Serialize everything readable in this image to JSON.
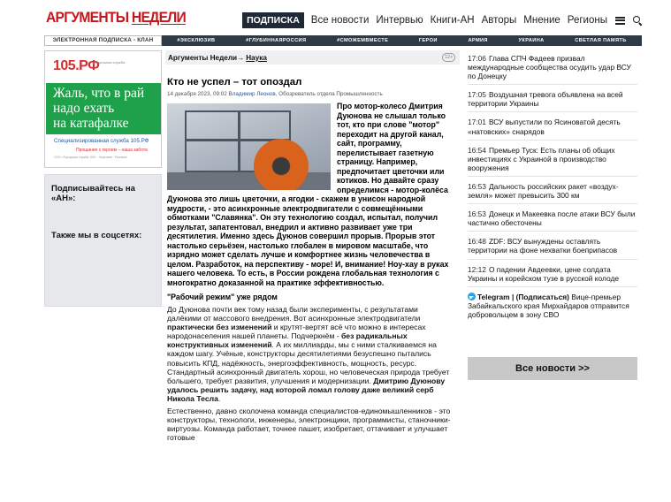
{
  "header": {
    "logo_part1": "АРГУМЕНТЫ ",
    "logo_part2": "НЕДЕЛИ",
    "nav": {
      "subscribe": "ПОДПИСКА",
      "items": [
        "Все новости",
        "Интервью",
        "Книги-АН",
        "Авторы",
        "Мнение",
        "Регионы"
      ]
    }
  },
  "subbar": {
    "left": "ЭЛЕКТРОННАЯ ПОДПИСКА - КЛАН",
    "tags": [
      "#ЭКСКЛЮЗИВ",
      "#ГЛУБИННАЯРОССИЯ",
      "#СМОЖЕМВМЕСТЕ",
      "ГЕРОИ",
      "АРМИЯ",
      "УКРАИНА",
      "СВЕТЛАЯ ПАМЯТЬ"
    ]
  },
  "ad": {
    "logo": "105.РФ",
    "logo_sub": "ритуальная служба",
    "headline_1": "Жаль, что в рай",
    "headline_2": "надо ехать",
    "headline_3": "на катафалке",
    "line1": "Специализированная служба 105.РФ",
    "line2": "Прощание с героем – наша забота",
    "small": "ООО «Городская служба 105» · Лицензия · Реклама"
  },
  "sidebar": {
    "subscribe": "Подписывайтесь на «АН»:",
    "social": "Также мы в соцсетях:"
  },
  "article": {
    "crumb_root": "Аргументы Недели",
    "crumb_sep": " → ",
    "crumb_section": "Наука",
    "age": "12+",
    "title": "Кто не успел – тот опоздал",
    "date": "14 декабря 2023, 09:02",
    "author": "Владимир Леонов,",
    "author_role": " Обозреватель отдела Промышленность",
    "lead": "Про мотор-колесо Дмитрия Дуюнова не слышал только тот, кто при слове \"мотор\" переходит на другой канал, сайт, программу, перелистывает газетную страницу. Например, предпочитает цветочки или котиков. Но давайте сразу определимся - мотор-колёса Дуюнова это лишь цветочки, а ягодки - скажем в унисон народной мудрости, - это асинхронные электродвигатели с совмещёнными обмотками \"Славянка\". Он эту технологию создал, испытал, получил результат, запатентовал, внедрил и активно развивает уже три десятилетия. Именно здесь Дуюнов совершил прорыв. Прорыв этот настолько серьёзен, настолько глобален в мировом масштабе, что изрядно может сделать лучше и комфортнее жизнь человечества в целом. Разработок, на перспективу - море! И, внимание! Ноу-хау в руках нашего человека. То есть, в России рождена глобальная технология с многократно доказанной на практике эффективностью.",
    "subhead": "\"Рабочий режим\" уже рядом",
    "p1_a": "До Дуюнова почти век тому назад были эксперименты, с результатами далёкими от массового внедрения. Вот асинхронные электродвигатели ",
    "p1_b": "практически без изменений",
    "p1_c": " и крутят-вертят всё что можно в интересах народонаселения нашей планеты. Подчеркнём - ",
    "p1_d": "без радикальных конструктивных изменений",
    "p1_e": ". А их миллиарды, мы с ними сталкиваемся на каждом  шагу. Учёные, конструкторы десятилетиями безуспешно пытались повысить КПД, надёжность, энергоэффективность, мощность, ресурс. Стандартный асинхронный двигатель хорош, но человеческая природа требует большего, требует развития, улучшения и модернизации. ",
    "p1_f": "Дмитрию Дуюнову удалось решить задачу, над которой ломал голову даже великий серб Никола Тесла",
    "p1_g": ".",
    "p2": "Естественно, давно сколочена команда специалистов-единомышленников - это конструкторы, технологи, инженеры, электронщики, программисты, станочники-виртуозы. Команда работает, точнее пашет, изобретает, оттачивает и улучшает готовые"
  },
  "news": {
    "items": [
      {
        "time": "17:06",
        "text": "Глава СПЧ Фадеев призвал международные сообщества осудить удар ВСУ по Донецку"
      },
      {
        "time": "17:05",
        "text": "Воздушная тревога объявлена на всей территории Украины"
      },
      {
        "time": "17:01",
        "text": "ВСУ выпустили по Ясиноватой десять «натовских» снарядов"
      },
      {
        "time": "16:54",
        "text": "Премьер Туск: Есть планы об общих инвестициях с Украиной в производство вооружения"
      },
      {
        "time": "16:53",
        "text": "Дальность российских ракет «воздух-земля» может превысить 300 км"
      },
      {
        "time": "16:53",
        "text": "Донецк и Макеевка после атаки ВСУ были частично обесточены"
      },
      {
        "time": "16:48",
        "text": "ZDF: ВСУ вынуждены оставлять территории на фоне нехватки боеприпасов"
      },
      {
        "time": "12:12",
        "text": "О падении Авдеевки, цене солдата Украины и корейском тузе в русской колоде"
      }
    ],
    "telegram_title": "Telegram | (Подписаться)",
    "telegram_text": " Вице-премьер Забайкальского края Мирхайдаров отправится добровольцем в зону СВО",
    "all_news": "Все новости >>"
  }
}
